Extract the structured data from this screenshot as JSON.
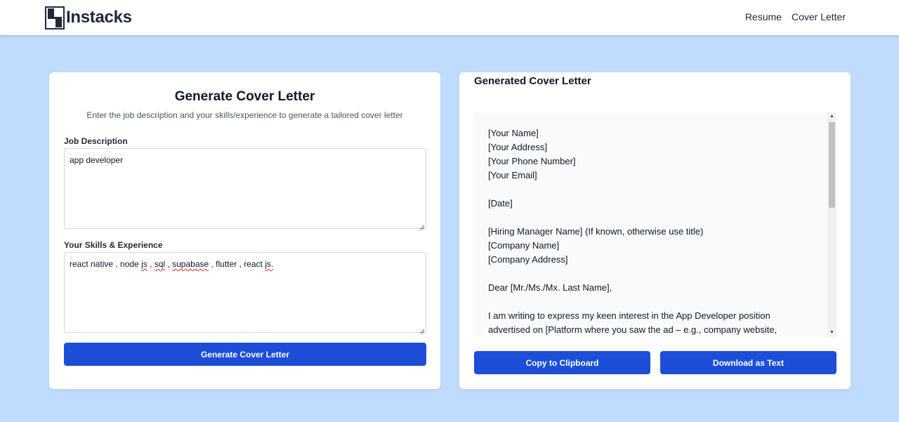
{
  "navbar": {
    "brand": "Instacks",
    "links": [
      "Resume",
      "Cover Letter"
    ]
  },
  "form": {
    "title": "Generate Cover Letter",
    "subtitle": "Enter the job description and your skills/experience to generate a tailored cover letter",
    "job_label": "Job Description",
    "job_value": "app developer",
    "skills_label": "Your Skills & Experience",
    "skills_parts": [
      "react native , node ",
      "js",
      " , ",
      "sql",
      " , ",
      "supabase",
      " , flutter , react ",
      "js."
    ],
    "submit_label": "Generate Cover Letter"
  },
  "output": {
    "title": "Generated Cover Letter",
    "letter_lines": [
      "[Your Name]",
      "[Your Address]",
      "[Your Phone Number]",
      "[Your Email]",
      "",
      "[Date]",
      "",
      "[Hiring Manager Name] (If known, otherwise use title)",
      "[Company Name]",
      "[Company Address]",
      "",
      "Dear [Mr./Ms./Mx. Last Name],",
      "",
      "I am writing to express my keen interest in the App Developer position",
      "advertised on [Platform where you saw the ad – e.g., company website,"
    ],
    "copy_label": "Copy to Clipboard",
    "download_label": "Download as Text"
  },
  "icons": [
    "logo-icon",
    "resize-grip-icon",
    "scroll-up-arrow-icon",
    "scroll-down-arrow-icon"
  ],
  "colors": {
    "background": "#bfdbfe",
    "primary_button": "#1d4ed8",
    "card": "#ffffff",
    "letter_bg": "#f9fafb"
  }
}
